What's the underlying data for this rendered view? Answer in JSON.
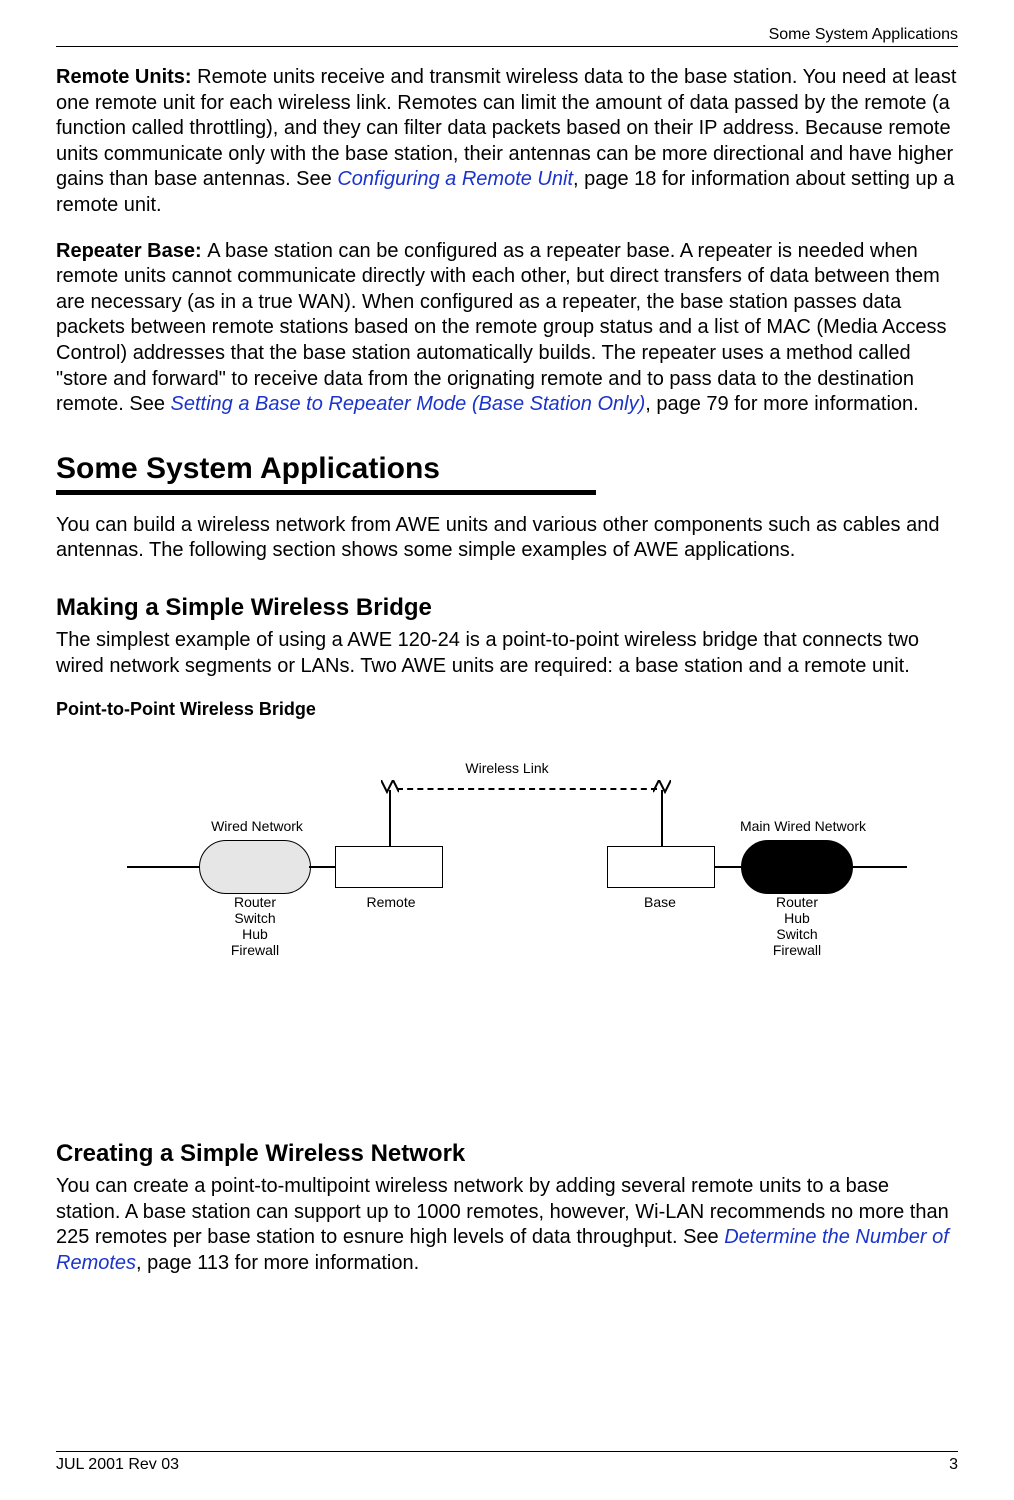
{
  "running_head": "Some System Applications",
  "para_remote_lead": "Remote Units: ",
  "para_remote_a": "Remote units receive and transmit wireless data to the base station. You need at least one remote unit for each wireless link. Remotes can limit the amount of data passed by the remote (a function called throttling), and they can filter data packets based on their IP address. Because remote units communicate only with the base station, their antennas can be more directional and have higher gains than base antennas. See ",
  "para_remote_link": "Configuring a Remote Unit",
  "para_remote_b": ", page 18 for information about setting up a remote unit.",
  "para_repeater_lead": "Repeater Base: ",
  "para_repeater_a": "A base station can be configured as a repeater base. A repeater is needed when remote units cannot communicate directly with each other, but direct transfers of data between them are necessary (as in a true WAN). When configured as a repeater, the base station passes data packets between remote stations based on the remote group status and a list of MAC (Media Access Control) addresses that the base station automatically builds. The repeater uses a method called \"store and forward\" to receive data from the orignating remote and to pass data to the destination remote. See ",
  "para_repeater_link": "Setting a Base to Repeater Mode (Base Station Only)",
  "para_repeater_b": ", page 79 for more information.",
  "h2": "Some System Applications",
  "para_intro": "You can build a wireless network from AWE units and various other components such as cables and antennas. The following section shows some simple examples of AWE applications.",
  "h3_bridge": "Making a Simple Wireless Bridge",
  "para_bridge": "The simplest example of using a AWE 120-24 is a point-to-point wireless bridge that connects two wired network segments or LANs. Two AWE units are required: a base station and a remote unit.",
  "fig_caption": "Point-to-Point Wireless Bridge",
  "diagram": {
    "wireless_link": "Wireless Link",
    "wired_network": "Wired Network",
    "main_wired_network": "Main Wired Network",
    "remote": "Remote",
    "base": "Base",
    "left_stack": {
      "l1": "Router",
      "l2": "Switch",
      "l3": "Hub",
      "l4": "Firewall"
    },
    "right_stack": {
      "l1": "Router",
      "l2": "Hub",
      "l3": "Switch",
      "l4": "Firewall"
    }
  },
  "h3_network": "Creating a Simple Wireless Network",
  "para_network_a": "You can create a point-to-multipoint wireless network by adding several remote units to a base station. A base station can support up to 1000 remotes, however, Wi-LAN recommends no more than 225 remotes per base station to esnure high levels of data throughput. See ",
  "para_network_link": "Determine the Number of Remotes",
  "para_network_b": ", page 113 for more information.",
  "footer_left": "JUL 2001 Rev 03",
  "footer_right": "3"
}
